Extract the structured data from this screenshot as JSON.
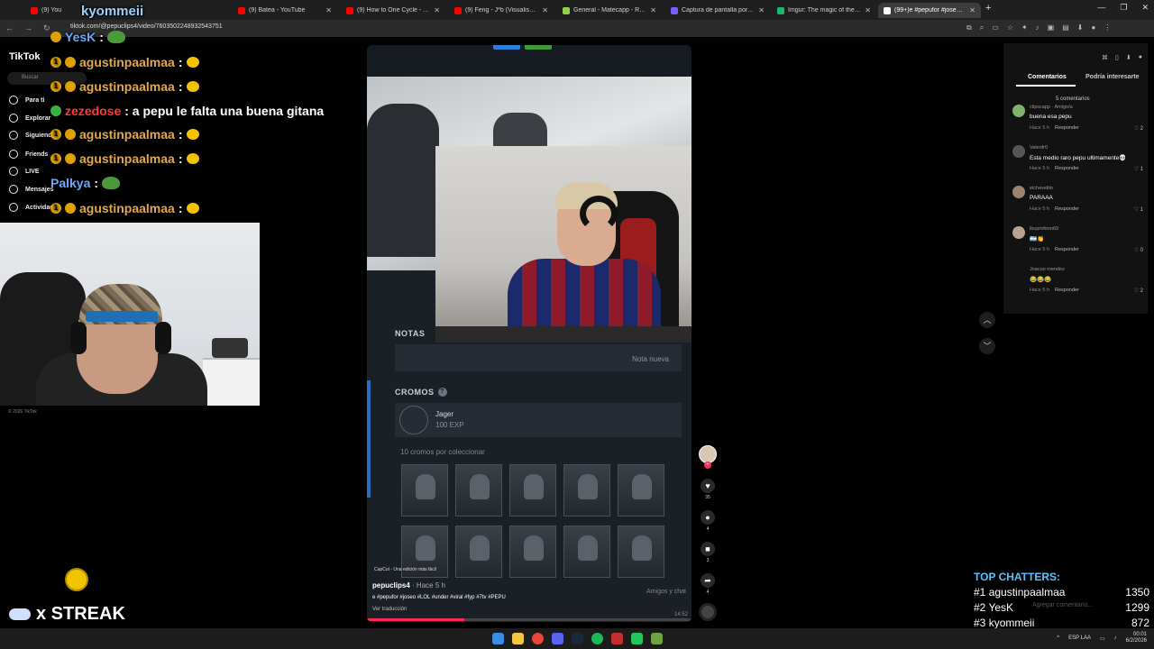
{
  "tabs": [
    {
      "title": "(9) You",
      "color": "#ff0000"
    },
    {
      "title": "(9) Batea - YouTube",
      "color": "#ff0000"
    },
    {
      "title": "(9) How to One Cycle - YouTube",
      "color": "#ff0000"
    },
    {
      "title": "(9) Feng - J*b (Visualiser) - YouT",
      "color": "#ff0000"
    },
    {
      "title": "General - Matecapp - Ranking",
      "color": "#8fd14f"
    },
    {
      "title": "Captura de pantalla por Lightsh",
      "color": "#7a5cff"
    },
    {
      "title": "Imgur: The magic of the Interne",
      "color": "#1bb76e"
    },
    {
      "title": "(99+)e #pepufor #joseo #LOL #",
      "color": "#ffffff"
    }
  ],
  "browser": {
    "url": "tiktok.com/@pepuclips4/video/7603502248932543751",
    "new_tab": "+"
  },
  "tiktok": {
    "logo": "TikTok",
    "search_placeholder": "Buscar",
    "nav": [
      "Para ti",
      "Explorar",
      "Siguiendo",
      "Friends",
      "LIVE",
      "Mensajes",
      "Actividad"
    ],
    "copyright": "© 2026 TikTok"
  },
  "chat": [
    {
      "user": "YesK",
      "color": "#6aa9ff",
      "text": ":",
      "emote": "pepe"
    },
    {
      "user": "agustinpaalmaa",
      "color": "#e0a84a",
      "text": ":",
      "emote": "face"
    },
    {
      "user": "agustinpaalmaa",
      "color": "#e0a84a",
      "text": ":",
      "emote": "face"
    },
    {
      "user": "zezedose",
      "color": "#ff3b3b",
      "text": ": a pepu le falta una buena gitana",
      "emote": ""
    },
    {
      "user": "agustinpaalmaa",
      "color": "#e0a84a",
      "text": ":",
      "emote": "face"
    },
    {
      "user": "agustinpaalmaa",
      "color": "#e0a84a",
      "text": ":",
      "emote": "face"
    },
    {
      "user": "Palkya",
      "color": "#6aa9ff",
      "text": ":",
      "emote": "pepe"
    },
    {
      "user": "agustinpaalmaa",
      "color": "#e0a84a",
      "text": ":",
      "emote": "face"
    }
  ],
  "chat_header_user": "kyommeii",
  "video": {
    "notas_label": "NOTAS",
    "nota_nueva": "Nota nueva",
    "cromos_label": "CROMOS",
    "cromos_help": "?",
    "operator_name": "Jager",
    "operator_exp": "100 EXP",
    "cromos_count": "10 cromos por coleccionar",
    "capcut": "CapCut - Una edición más fácil",
    "username": "pepuclips4",
    "posted": "· Hace 5 h",
    "description": "e #pepufor #joseo #LOL #under #viral #fyp #7tv #PEPU",
    "translate": "Ver traducción",
    "amigos_chat": "Amigos y chat",
    "duration": "14:52",
    "progress": 0.3
  },
  "actions": {
    "likes": "35",
    "comments": "4",
    "saves": "3",
    "shares": "4"
  },
  "comments_panel": {
    "tab_comments": "Comentarios",
    "tab_related": "Podría interesarte",
    "count": "5 comentarios",
    "items": [
      {
        "user": "clipscapp · Amigo/a",
        "text": "buena esa pepu",
        "time": "Hace 5 h",
        "reply": "Responder",
        "likes": "2",
        "avatar": "#7fb36a"
      },
      {
        "user": "Valenfr0",
        "text": "Esta medio raro pepu ultimamente💀",
        "time": "Hace 5 h",
        "reply": "Responder",
        "likes": "1",
        "avatar": "#555555"
      },
      {
        "user": "elchevelito",
        "text": "PARAAA",
        "time": "Hace 5 h",
        "reply": "Responder",
        "likes": "1",
        "avatar": "#9a8470"
      },
      {
        "user": "ibuprofeno69",
        "text": "🇦🇷👏",
        "time": "Hace 5 h",
        "reply": "Responder",
        "likes": "0",
        "avatar": "#b7a38d"
      },
      {
        "user": "Joacoo mendez",
        "text": "😂😂😂",
        "time": "Hace 5 h",
        "reply": "Responder",
        "likes": "2",
        "avatar": "#121212"
      }
    ]
  },
  "top_chatters": {
    "title": "TOP CHATTERS:",
    "rows": [
      {
        "rank": "#1",
        "name": "agustinpaalmaa",
        "count": "1350"
      },
      {
        "rank": "#2",
        "name": "YesK",
        "count": "1299"
      },
      {
        "rank": "#3",
        "name": "kyommeii",
        "count": "872"
      }
    ]
  },
  "comment_input_placeholder": "Agregar comentario...",
  "streak": {
    "label": "x STREAK"
  },
  "taskbar": {
    "lang": "ESP LAA",
    "time": "00:01",
    "date": "6/2/2026"
  }
}
